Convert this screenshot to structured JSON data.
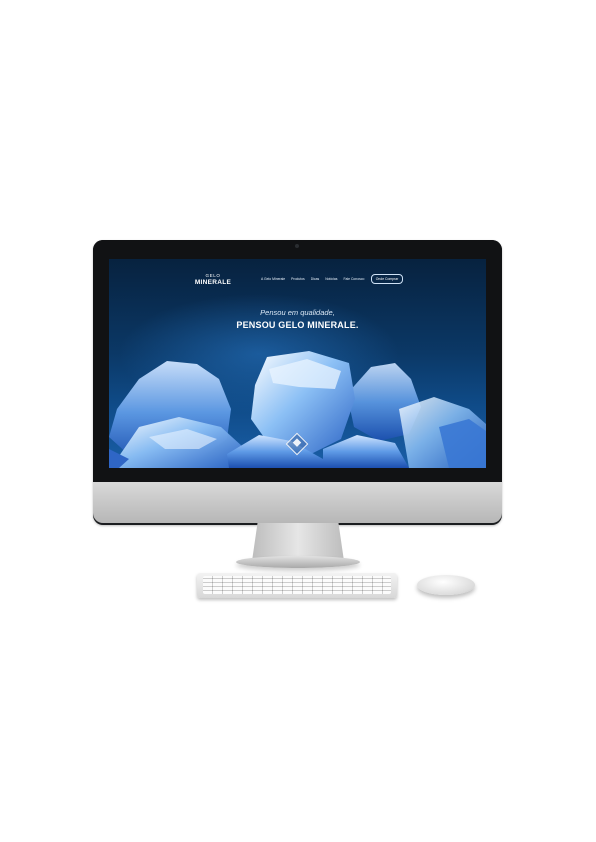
{
  "site": {
    "logo": {
      "line1": "GELO",
      "line2": "MINERALE"
    },
    "nav": [
      {
        "label": "A Gelo Minerale"
      },
      {
        "label": "Produtos"
      },
      {
        "label": "Dicas"
      },
      {
        "label": "Notícias"
      },
      {
        "label": "Fale Conosco"
      }
    ],
    "cta_label": "Onde Comprar",
    "hero": {
      "line1": "Pensou em qualidade,",
      "line2": "PENSOU GELO MINERALE."
    }
  },
  "colors": {
    "screen_top": "#07223f",
    "screen_bottom": "#1a5fa8",
    "ice": "#6fa9ec",
    "monitor_chin": "#c4c4c4"
  }
}
